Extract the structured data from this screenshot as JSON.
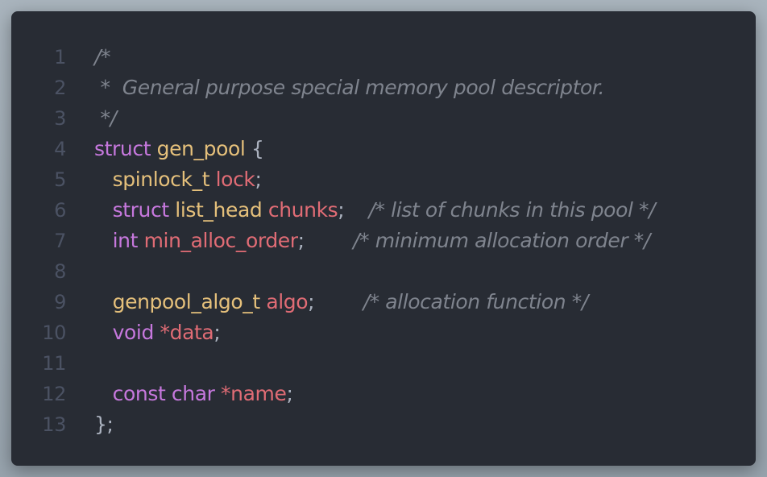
{
  "editor": {
    "language": "c",
    "lines": [
      {
        "num": "1",
        "tokens": [
          {
            "t": "/*",
            "k": "cm"
          }
        ]
      },
      {
        "num": "2",
        "tokens": [
          {
            "t": " *  General purpose special memory pool descriptor.",
            "k": "cm"
          }
        ]
      },
      {
        "num": "3",
        "tokens": [
          {
            "t": " */",
            "k": "cm"
          }
        ]
      },
      {
        "num": "4",
        "tokens": [
          {
            "t": "struct",
            "k": "kw"
          },
          {
            "t": " ",
            "k": "pn"
          },
          {
            "t": "gen_pool",
            "k": "ty"
          },
          {
            "t": " {",
            "k": "pn"
          }
        ]
      },
      {
        "num": "5",
        "tokens": [
          {
            "t": "   ",
            "k": "pn"
          },
          {
            "t": "spinlock_t",
            "k": "ty"
          },
          {
            "t": " ",
            "k": "pn"
          },
          {
            "t": "lock",
            "k": "id"
          },
          {
            "t": ";",
            "k": "pn"
          }
        ]
      },
      {
        "num": "6",
        "tokens": [
          {
            "t": "   ",
            "k": "pn"
          },
          {
            "t": "struct",
            "k": "kw"
          },
          {
            "t": " ",
            "k": "pn"
          },
          {
            "t": "list_head",
            "k": "ty"
          },
          {
            "t": " ",
            "k": "pn"
          },
          {
            "t": "chunks",
            "k": "id"
          },
          {
            "t": ";    ",
            "k": "pn"
          },
          {
            "t": "/* list of chunks in this pool */",
            "k": "cm"
          }
        ]
      },
      {
        "num": "7",
        "tokens": [
          {
            "t": "   ",
            "k": "pn"
          },
          {
            "t": "int",
            "k": "kw"
          },
          {
            "t": " ",
            "k": "pn"
          },
          {
            "t": "min_alloc_order",
            "k": "id"
          },
          {
            "t": ";        ",
            "k": "pn"
          },
          {
            "t": "/* minimum allocation order */",
            "k": "cm"
          }
        ]
      },
      {
        "num": "8",
        "tokens": []
      },
      {
        "num": "9",
        "tokens": [
          {
            "t": "   ",
            "k": "pn"
          },
          {
            "t": "genpool_algo_t",
            "k": "ty"
          },
          {
            "t": " ",
            "k": "pn"
          },
          {
            "t": "algo",
            "k": "id"
          },
          {
            "t": ";        ",
            "k": "pn"
          },
          {
            "t": "/* allocation function */",
            "k": "cm"
          }
        ]
      },
      {
        "num": "10",
        "tokens": [
          {
            "t": "   ",
            "k": "pn"
          },
          {
            "t": "void",
            "k": "kw"
          },
          {
            "t": " ",
            "k": "pn"
          },
          {
            "t": "*",
            "k": "id"
          },
          {
            "t": "data",
            "k": "id"
          },
          {
            "t": ";",
            "k": "pn"
          }
        ]
      },
      {
        "num": "11",
        "tokens": []
      },
      {
        "num": "12",
        "tokens": [
          {
            "t": "   ",
            "k": "pn"
          },
          {
            "t": "const",
            "k": "kw"
          },
          {
            "t": " ",
            "k": "pn"
          },
          {
            "t": "char",
            "k": "kw"
          },
          {
            "t": " ",
            "k": "pn"
          },
          {
            "t": "*",
            "k": "id"
          },
          {
            "t": "name",
            "k": "id"
          },
          {
            "t": ";",
            "k": "pn"
          }
        ]
      },
      {
        "num": "13",
        "tokens": [
          {
            "t": "};",
            "k": "pn"
          }
        ]
      }
    ]
  },
  "colors": {
    "background": "#282c34",
    "line_number": "#4b5263",
    "keyword": "#c678dd",
    "type": "#e5c07b",
    "identifier": "#e06c75",
    "punctuation": "#abb2bf",
    "comment": "#7f848e"
  }
}
